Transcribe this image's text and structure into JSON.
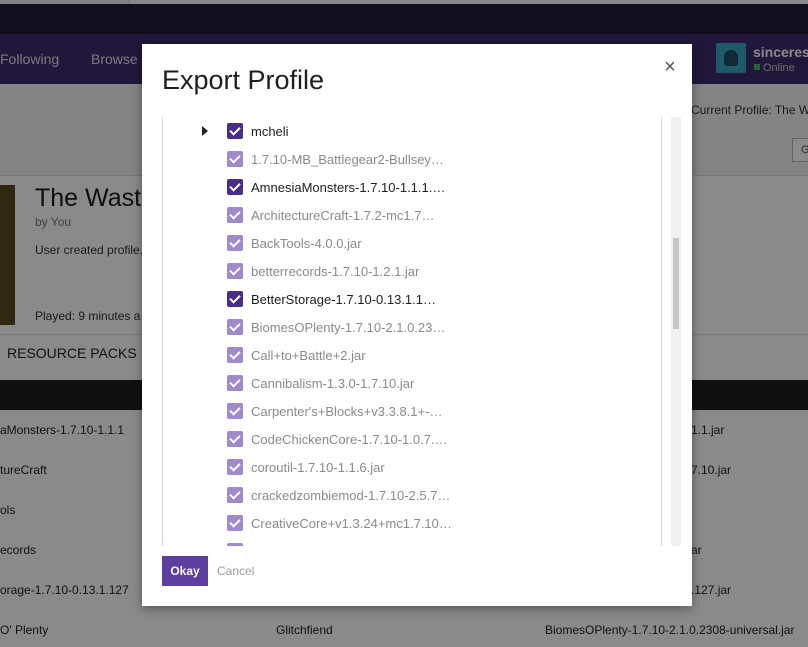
{
  "nav": {
    "following": "Following",
    "browse": "Browse"
  },
  "user": {
    "name": "sinceresa",
    "status": "Online"
  },
  "header": {
    "current_profile": "Current Profile: The W",
    "small_button": "G"
  },
  "profile": {
    "title": "The Waste",
    "by": "by You",
    "description": "User created profile.",
    "played": "Played: 9 minutes a"
  },
  "tabs": {
    "resource_packs": "RESOURCE PACKS"
  },
  "table_rows": [
    {
      "col1": "aMonsters-1.7.10-1.1.1",
      "col3": "1.1.jar"
    },
    {
      "col1": "tureCraft",
      "col3": "7.10.jar"
    },
    {
      "col1": "ols",
      "col3": ""
    },
    {
      "col1": "ecords",
      "col3": "ar"
    },
    {
      "col1": "orage-1.7.10-0.13.1.127",
      "col3": ".127.jar"
    },
    {
      "col1": "O' Plenty",
      "col2": "Glitchfiend",
      "col3": "BiomesOPlenty-1.7.10-2.1.0.2308-universal.jar"
    }
  ],
  "modal": {
    "title": "Export Profile",
    "close_label": "×",
    "items": [
      {
        "label": "mcheli",
        "checked": true,
        "dark": true,
        "expander": true
      },
      {
        "label": "1.7.10-MB_Battlegear2-Bullsey…",
        "checked": true,
        "dark": false
      },
      {
        "label": "AmnesiaMonsters-1.7.10-1.1.1.…",
        "checked": true,
        "dark": true
      },
      {
        "label": "ArchitectureCraft-1.7.2-mc1.7…",
        "checked": true,
        "dark": false
      },
      {
        "label": "BackTools-4.0.0.jar",
        "checked": true,
        "dark": false
      },
      {
        "label": "betterrecords-1.7.10-1.2.1.jar",
        "checked": true,
        "dark": false
      },
      {
        "label": "BetterStorage-1.7.10-0.13.1.1…",
        "checked": true,
        "dark": true
      },
      {
        "label": "BiomesOPlenty-1.7.10-2.1.0.23…",
        "checked": true,
        "dark": false
      },
      {
        "label": "Call+to+Battle+2.jar",
        "checked": true,
        "dark": false
      },
      {
        "label": "Cannibalism-1.3.0-1.7.10.jar",
        "checked": true,
        "dark": false
      },
      {
        "label": "Carpenter's+Blocks+v3.3.8.1+-…",
        "checked": true,
        "dark": false
      },
      {
        "label": "CodeChickenCore-1.7.10-1.0.7.…",
        "checked": true,
        "dark": false
      },
      {
        "label": "coroutil-1.7.10-1.1.6.jar",
        "checked": true,
        "dark": false
      },
      {
        "label": "crackedzombiemod-1.7.10-2.5.7…",
        "checked": true,
        "dark": false
      },
      {
        "label": "CreativeCore+v1.3.24+mc1.7.10…",
        "checked": true,
        "dark": false
      },
      {
        "label": "",
        "checked": true,
        "dark": false
      }
    ],
    "okay_label": "Okay",
    "cancel_label": "Cancel"
  }
}
